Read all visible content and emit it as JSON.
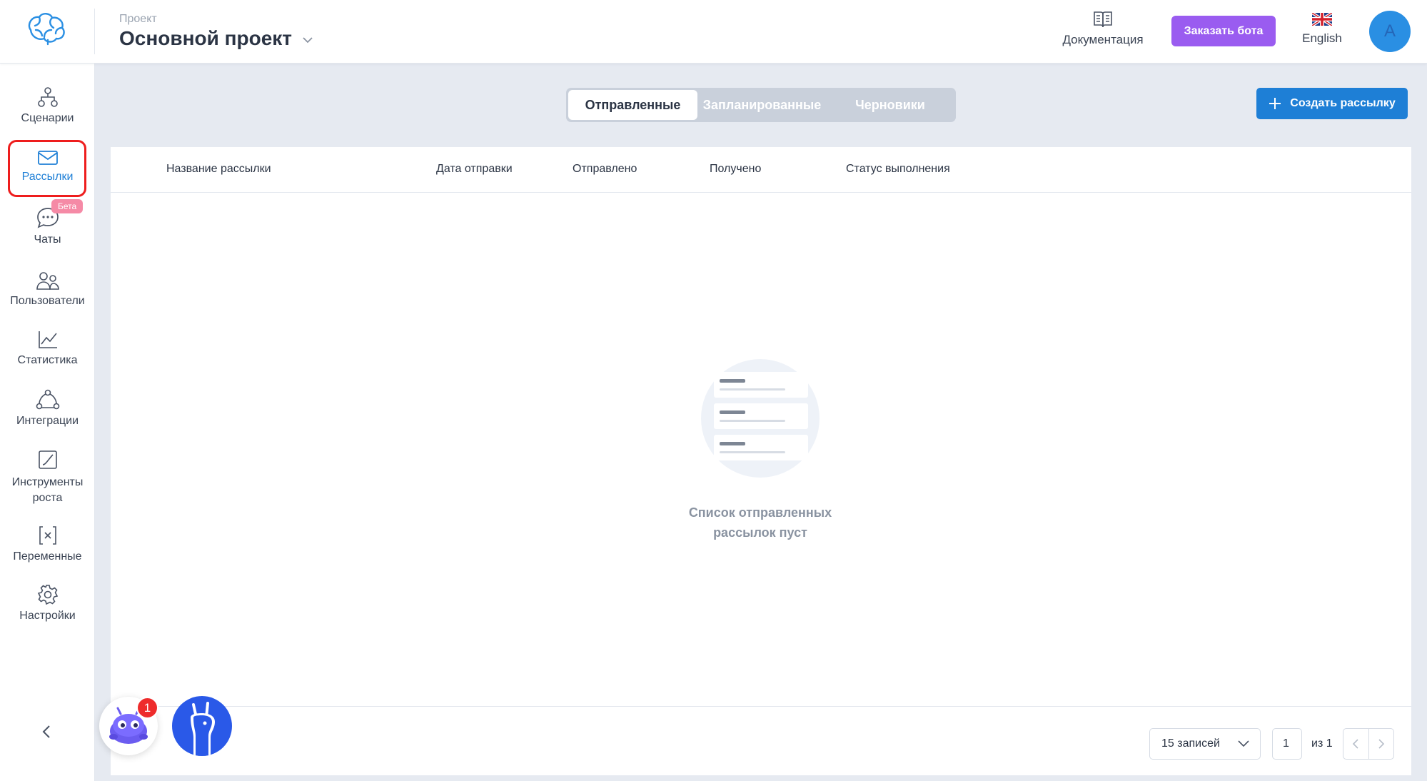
{
  "header": {
    "project_caption": "Проект",
    "project_name": "Основной проект",
    "docs_label": "Документация",
    "order_bot_label": "Заказать бота",
    "language_label": "English",
    "avatar_letter": "A"
  },
  "sidebar": {
    "items": [
      {
        "label": "Сценарии",
        "icon": "scenarios-icon"
      },
      {
        "label": "Рассылки",
        "icon": "mail-icon",
        "active": true
      },
      {
        "label": "Чаты",
        "icon": "chat-icon",
        "badge": "Бета"
      },
      {
        "label": "Пользователи",
        "icon": "users-icon"
      },
      {
        "label": "Статистика",
        "icon": "chart-icon"
      },
      {
        "label": "Интеграции",
        "icon": "integrations-icon"
      },
      {
        "label": "Инструменты роста",
        "icon": "growth-icon"
      },
      {
        "label": "Переменные",
        "icon": "variables-icon"
      },
      {
        "label": "Настройки",
        "icon": "settings-icon"
      }
    ]
  },
  "main": {
    "tabs": [
      {
        "label": "Отправленные",
        "active": true
      },
      {
        "label": "Запланированные"
      },
      {
        "label": "Черновики"
      }
    ],
    "create_button": "Создать рассылку",
    "table": {
      "columns": [
        "Название рассылки",
        "Дата отправки",
        "Отправлено",
        "Получено",
        "Статус выполнения"
      ]
    },
    "empty_text": "Список отправленных рассылок пуст",
    "pagination": {
      "per_page": "15 записей",
      "page": "1",
      "of": "из 1"
    }
  },
  "widgets": {
    "notification_count": "1"
  },
  "colors": {
    "accent": "#1e7fd6",
    "order_button": "#9a5cf0",
    "beta_badge": "#f58aa6",
    "highlight_frame": "#ee1d1d"
  }
}
